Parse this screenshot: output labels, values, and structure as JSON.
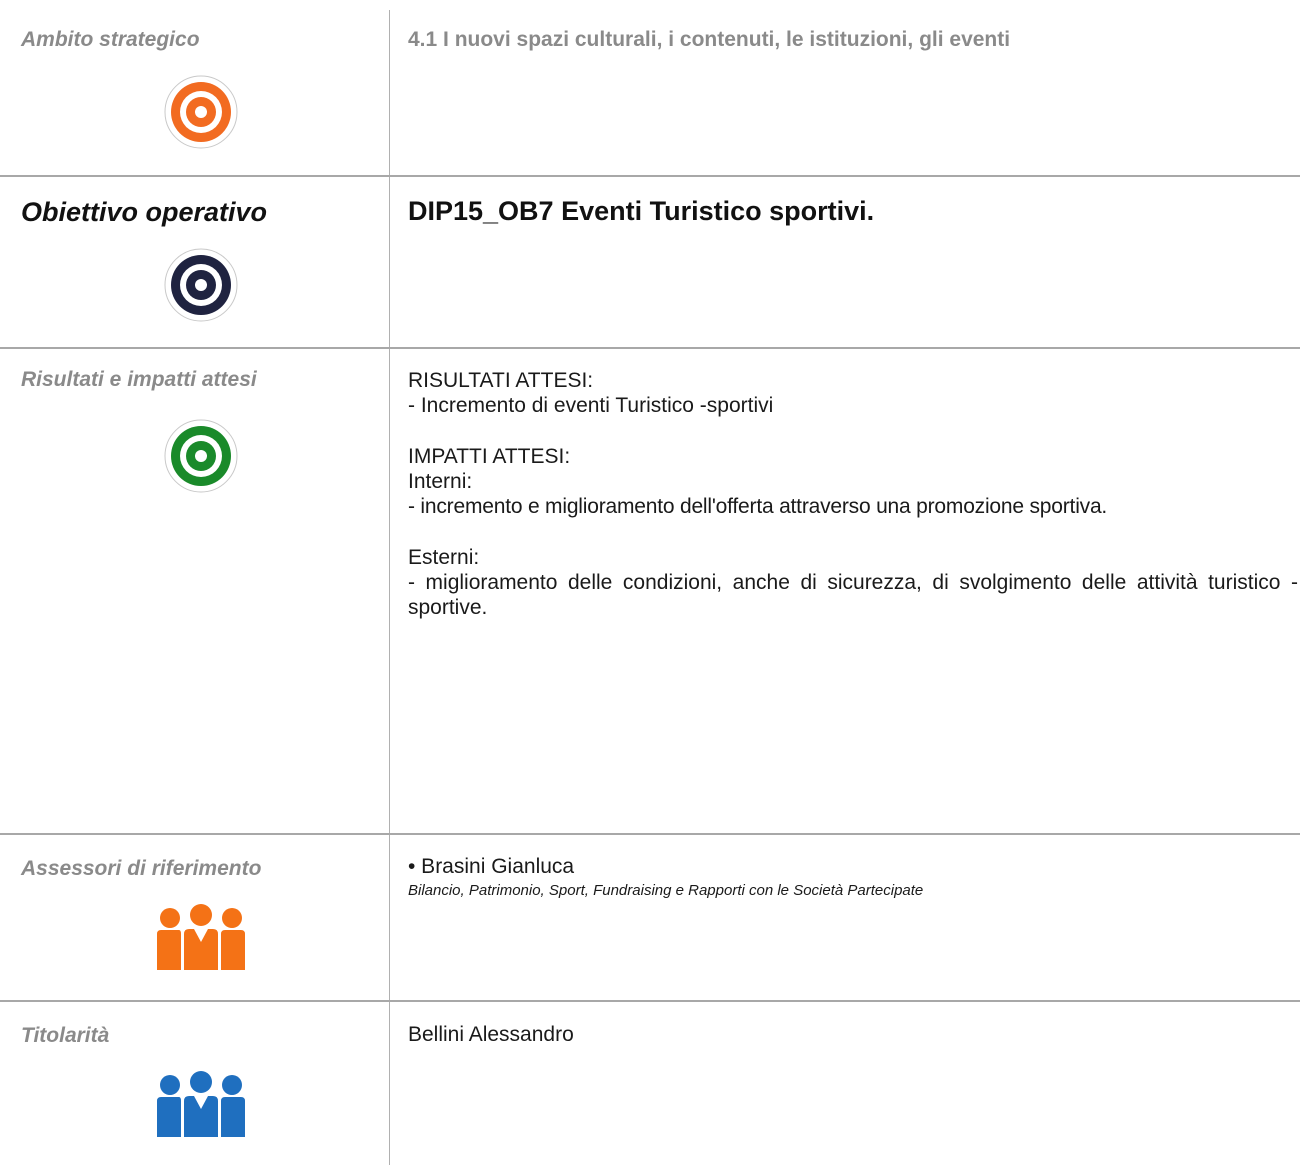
{
  "ambito": {
    "label": "Ambito strategico",
    "value": "4.1 I nuovi spazi culturali, i contenuti, le istituzioni, gli eventi",
    "icon": "target-icon",
    "icon_color": "#f26b21"
  },
  "obiettivo": {
    "label": "Obiettivo operativo",
    "value": "DIP15_OB7 Eventi Turistico sportivi.",
    "icon": "target-icon",
    "icon_color": "#1f2340"
  },
  "risultati": {
    "label": "Risultati e impatti attesi",
    "icon": "target-icon",
    "icon_color": "#1a8a2a",
    "risultati_heading": "RISULTATI ATTESI:",
    "risultati_item": "- Incremento di eventi Turistico -sportivi",
    "impatti_heading": "IMPATTI ATTESI:",
    "interni_heading": "Interni:",
    "interni_item": "- incremento e miglioramento dell'offerta attraverso una promozione sportiva.",
    "esterni_heading": "Esterni:",
    "esterni_item": "- miglioramento delle condizioni, anche di sicurezza, di svolgimento delle attività turistico -sportive."
  },
  "assessori": {
    "label": "Assessori di riferimento",
    "icon": "people-group-icon",
    "icon_color": "#f47216",
    "name": "• Brasini Gianluca",
    "role": "Bilancio, Patrimonio, Sport, Fundraising e Rapporti con le Società Partecipate"
  },
  "titolarita": {
    "label": "Titolarità",
    "icon": "people-group-icon",
    "icon_color": "#1f6fbf",
    "value": "Bellini Alessandro"
  }
}
